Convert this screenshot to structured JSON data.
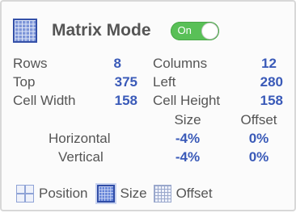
{
  "header": {
    "icon": "grid-icon",
    "title": "Matrix Mode",
    "toggle_label": "On",
    "toggle_state": "on"
  },
  "fields": {
    "rows_label": "Rows",
    "rows_value": "8",
    "columns_label": "Columns",
    "columns_value": "12",
    "top_label": "Top",
    "top_value": "375",
    "left_label": "Left",
    "left_value": "280",
    "cell_width_label": "Cell Width",
    "cell_width_value": "158",
    "cell_height_label": "Cell Height",
    "cell_height_value": "158"
  },
  "spacing": {
    "size_header": "Size",
    "offset_header": "Offset",
    "horizontal_label": "Horizontal",
    "horizontal_size": "-4%",
    "horizontal_offset": "0%",
    "vertical_label": "Vertical",
    "vertical_size": "-4%",
    "vertical_offset": "0%"
  },
  "modes": {
    "position_label": "Position",
    "size_label": "Size",
    "offset_label": "Offset",
    "selected": "Size"
  },
  "colors": {
    "accent": "#3a5ab8",
    "toggle_on": "#59c057"
  }
}
